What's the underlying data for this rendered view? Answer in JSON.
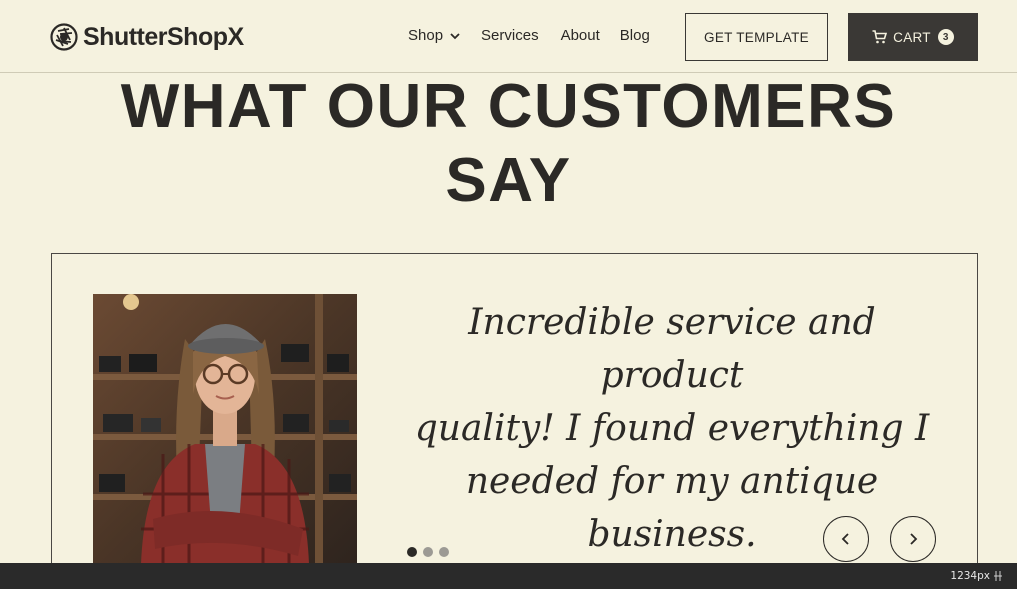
{
  "header": {
    "logo_text": "ShutterShopX",
    "logo_icon": "camera-aperture-icon",
    "nav": [
      {
        "label": "Shop",
        "has_dropdown": true
      },
      {
        "label": "Services"
      },
      {
        "label": "About"
      },
      {
        "label": "Blog"
      }
    ],
    "template_button": "GET TEMPLATE",
    "cart": {
      "label": "CART",
      "count": "3",
      "icon": "cart-icon"
    }
  },
  "section": {
    "title_line1": "WHAT OUR CUSTOMERS",
    "title_line2": "SAY"
  },
  "testimonial": {
    "quote_lines": [
      "Incredible service and product",
      "quality! I found everything I",
      "needed for my antique",
      "business."
    ],
    "dots": {
      "count": 3,
      "active_index": 0
    },
    "prev_icon": "chevron-left-icon",
    "next_icon": "chevron-right-icon"
  },
  "devtools": {
    "width_readout": "1234px"
  },
  "colors": {
    "background": "#f5f2df",
    "text": "#2b2926",
    "dark_button": "#3a3835",
    "dot_inactive": "#9c9a94"
  }
}
